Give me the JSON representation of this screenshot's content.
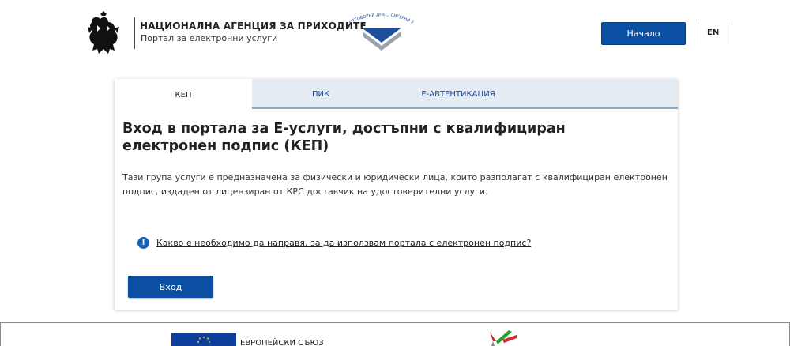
{
  "header": {
    "agency_title": "НАЦИОНАЛНА АГЕНЦИЯ ЗА ПРИХОДИТЕ",
    "agency_subtitle": "Портал за електронни услуги",
    "logo_slogan": "ОТГОВОРНИ ДНЕС, СИГУРНИ ЗА УТРЕ",
    "home_button": "Начало",
    "lang_switch": "EN"
  },
  "tabs": [
    {
      "label": "КЕП",
      "active": true
    },
    {
      "label": "ПИК",
      "active": false
    },
    {
      "label": "Е-АВТЕНТИКАЦИЯ",
      "active": false
    }
  ],
  "main": {
    "title": "Вход в портала за Е-услуги, достъпни с квалифициран електронен подпис (КЕП)",
    "description": "Тази група услуги е предназначена за физически и юридически лица, които разполагат с квалифициран електронен подпис, издаден от лицензиран от КРС доставчик на удостоверителни услуги.",
    "info_link": "Какво е необходимо да направя, за да използвам портала с електронен подпис?",
    "login_button": "Вход"
  },
  "footer": {
    "eu_text": "ЕВРОПЕЙСКИ СЪЮЗ"
  },
  "colors": {
    "primary": "#0b4fa2",
    "tab_bg": "#e4ebf3"
  }
}
